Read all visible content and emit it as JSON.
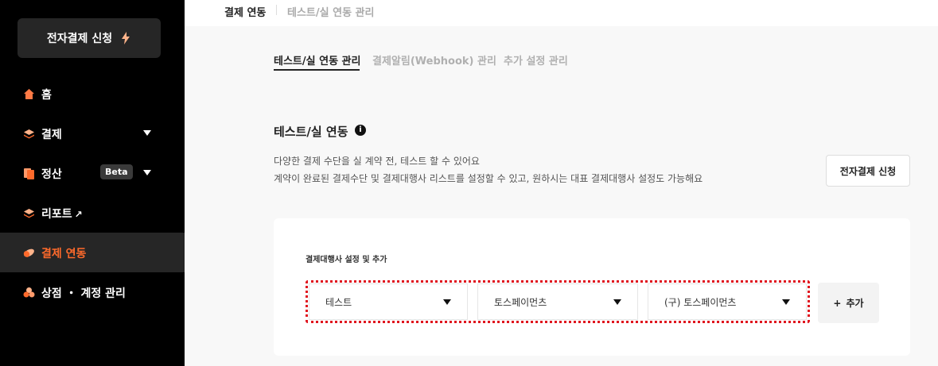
{
  "sidebar": {
    "apply_button": "전자결제 신청",
    "items": [
      {
        "label": "홈"
      },
      {
        "label": "결제"
      },
      {
        "label": "정산",
        "badge": "Beta"
      },
      {
        "label": "리포트"
      },
      {
        "label": "결제 연동"
      },
      {
        "label": "상점 ・ 계정 관리"
      }
    ]
  },
  "breadcrumb": {
    "current": "결제 연동",
    "sub": "테스트/실 연동 관리"
  },
  "tabs": [
    "테스트/실 연동 관리",
    "결제알림(Webhook) 관리",
    "추가 설정 관리"
  ],
  "section": {
    "title": "테스트/실 연동",
    "desc_line1": "다양한 결제 수단을 실 계약 전, 테스트 할 수 있어요",
    "desc_line2": "계약이 완료된 결제수단 및 결제대행사 리스트를 설정할 수 있고, 원하시는 대표 결제대행사 설정도 가능해요",
    "apply_button": "전자결제 신청"
  },
  "pg_card": {
    "label": "결제대행사 설정 및 추가",
    "selects": [
      "테스트",
      "토스페이먼츠",
      "(구) 토스페이먼츠"
    ],
    "add_button": "추가"
  },
  "colors": {
    "sidebar_bg": "#000000",
    "accent": "#ff6a2b",
    "highlight": "#e0141e"
  }
}
